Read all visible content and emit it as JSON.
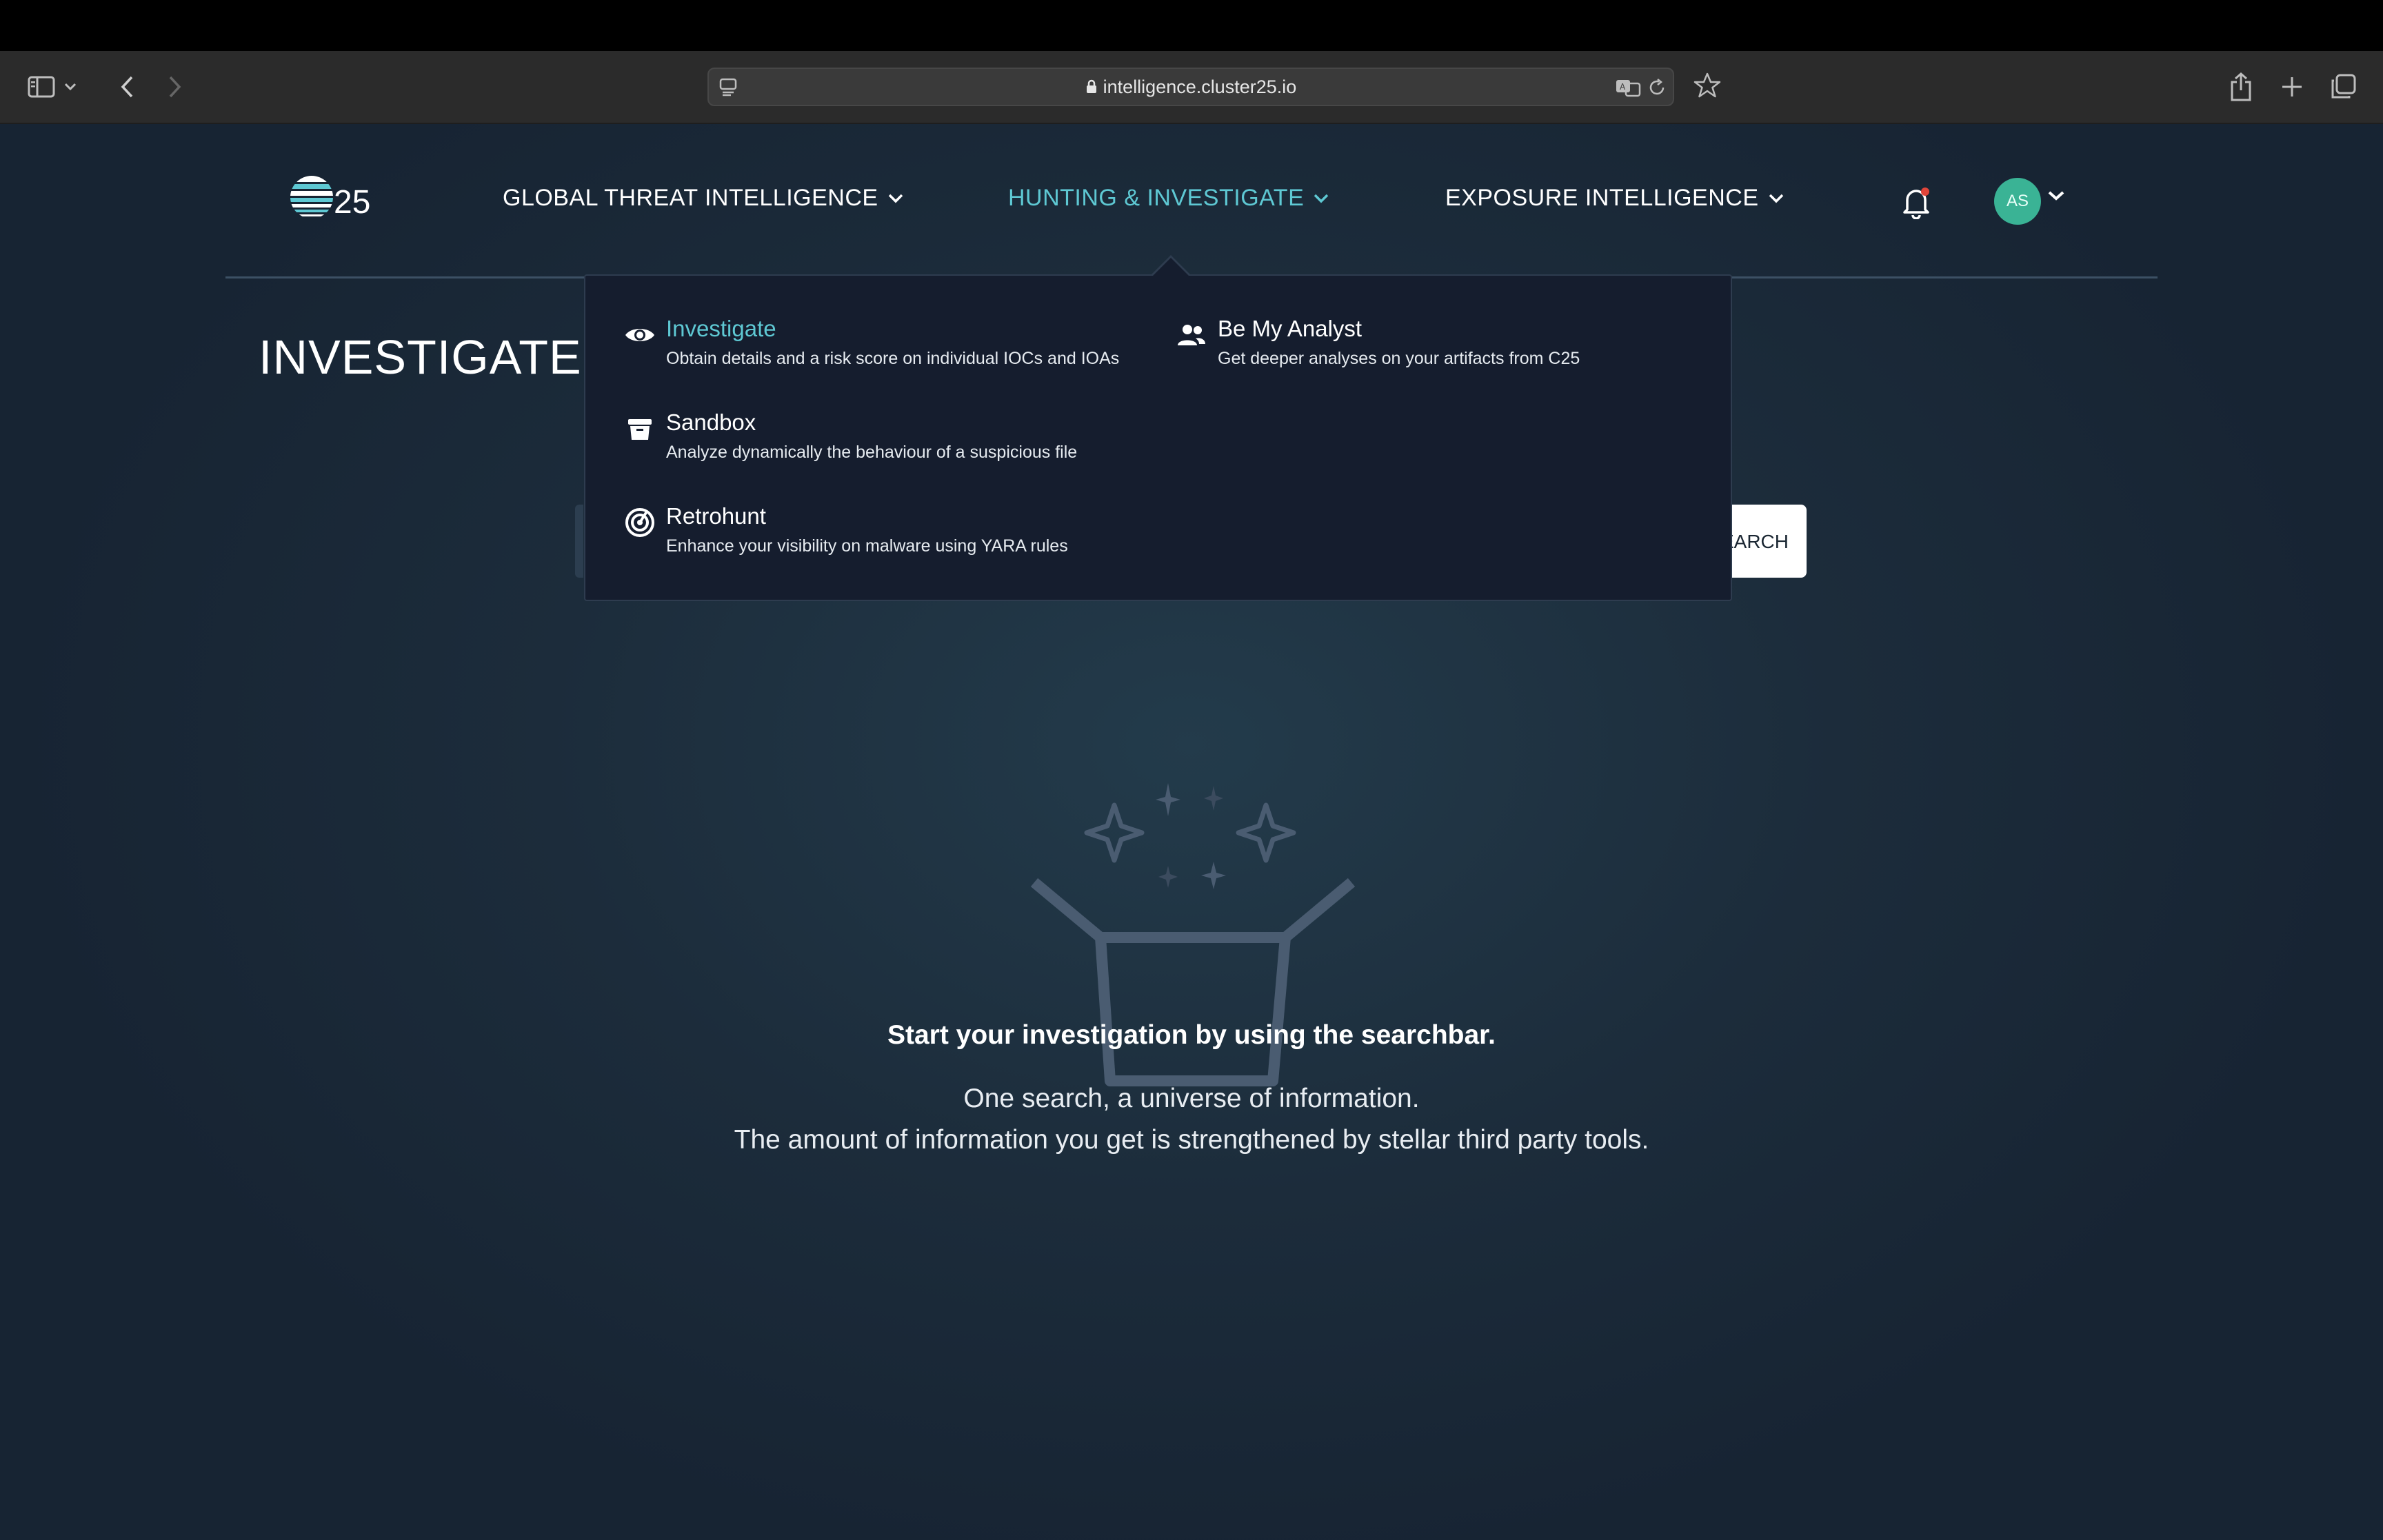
{
  "browser": {
    "url": "intelligence.cluster25.io"
  },
  "nav": {
    "logo_text": "25",
    "items": [
      {
        "label": "GLOBAL THREAT INTELLIGENCE"
      },
      {
        "label": "HUNTING & INVESTIGATE"
      },
      {
        "label": "EXPOSURE INTELLIGENCE"
      }
    ],
    "active_item": "HUNTING & INVESTIGATE",
    "avatar_initials": "AS"
  },
  "page": {
    "title": "INVESTIGATE",
    "search_button_label": "EARCH"
  },
  "dropdown": {
    "items": [
      {
        "title": "Investigate",
        "description": "Obtain details and a risk score on individual IOCs and IOAs",
        "icon": "eye-icon"
      },
      {
        "title": "Be My Analyst",
        "description": "Get deeper analyses on your artifacts from C25",
        "icon": "users-icon"
      },
      {
        "title": "Sandbox",
        "description": "Analyze dynamically the behaviour of a suspicious file",
        "icon": "box-icon"
      },
      {
        "title": "Retrohunt",
        "description": "Enhance your visibility on malware using YARA rules",
        "icon": "radar-icon"
      }
    ]
  },
  "empty_state": {
    "headline": "Start your investigation by using the searchbar.",
    "line1": "One search, a universe of information.",
    "line2": "The amount of information you get is strengthened by stellar third party tools."
  },
  "colors": {
    "accent": "#5ec8d3",
    "avatar": "#3ab395",
    "background": "#1b2a38",
    "dropdown_bg": "#151d2e"
  }
}
